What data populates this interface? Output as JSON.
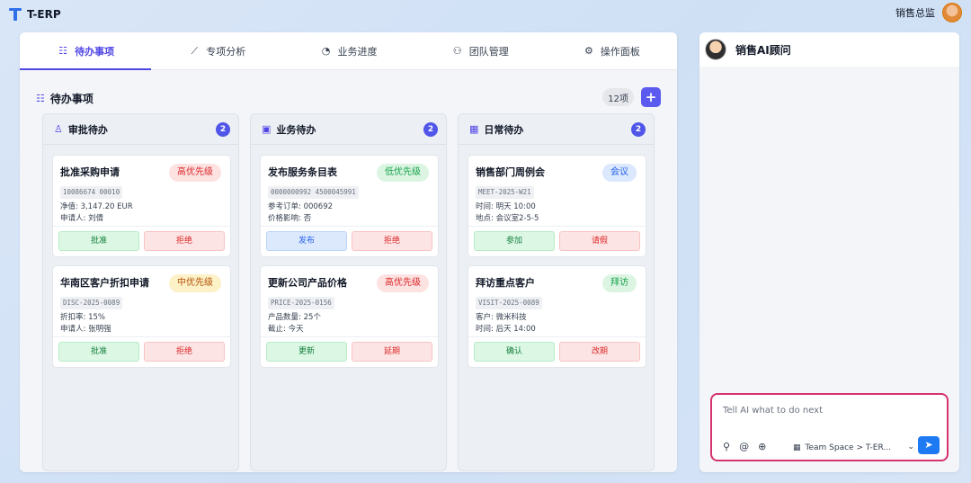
{
  "app": {
    "name": "T-ERP",
    "user_name": "销售总监"
  },
  "tabs": [
    {
      "label": "待办事项",
      "icon": "checklist-icon",
      "active": true
    },
    {
      "label": "专项分析",
      "icon": "chart-line-icon",
      "active": false
    },
    {
      "label": "业务进度",
      "icon": "pie-chart-icon",
      "active": false
    },
    {
      "label": "团队管理",
      "icon": "team-icon",
      "active": false
    },
    {
      "label": "操作面板",
      "icon": "gears-icon",
      "active": false
    }
  ],
  "section": {
    "title": "待办事项",
    "count_label": "12项",
    "add_label": "+"
  },
  "columns": [
    {
      "title": "审批待办",
      "count": "2",
      "icon": "stamp-icon",
      "cards": [
        {
          "title": "批准采购申请",
          "badge": "高优先级",
          "code": "10086674 00010",
          "line1": "净值: 3,147.20 EUR",
          "line2": "申请人: 刘倩",
          "btn1": "批准",
          "btn2": "拒绝"
        },
        {
          "title": "华南区客户折扣申请",
          "badge": "中优先级",
          "code": "DISC-2025-0089",
          "line1": "折扣率: 15%",
          "line2": "申请人: 张明强",
          "btn1": "批准",
          "btn2": "拒绝"
        }
      ]
    },
    {
      "title": "业务待办",
      "count": "2",
      "icon": "briefcase-icon",
      "cards": [
        {
          "title": "发布服务条目表",
          "badge": "低优先级",
          "code": "0000000992 4500045991",
          "line1": "参考订单: 000692",
          "line2": "价格影响: 否",
          "btn1": "发布",
          "btn2": "拒绝"
        },
        {
          "title": "更新公司产品价格",
          "badge": "高优先级",
          "code": "PRICE-2025-0156",
          "line1": "产品数量: 25个",
          "line2": "截止: 今天",
          "btn1": "更新",
          "btn2": "延期"
        }
      ]
    },
    {
      "title": "日常待办",
      "count": "2",
      "icon": "calendar-icon",
      "cards": [
        {
          "title": "销售部门周例会",
          "badge": "会议",
          "code": "MEET-2025-W21",
          "line1": "时间: 明天 10:00",
          "line2": "地点: 会议室2-5-5",
          "btn1": "参加",
          "btn2": "请假"
        },
        {
          "title": "拜访重点客户",
          "badge": "拜访",
          "code": "VISIT-2025-0089",
          "line1": "客户: 微米科技",
          "line2": "时间: 后天 14:00",
          "btn1": "确认",
          "btn2": "改期"
        }
      ]
    }
  ],
  "ai_panel": {
    "title": "销售AI顾问",
    "placeholder": "Tell AI what to do next",
    "space_label": "Team Space > T-ER...",
    "send_icon": "send-icon"
  }
}
